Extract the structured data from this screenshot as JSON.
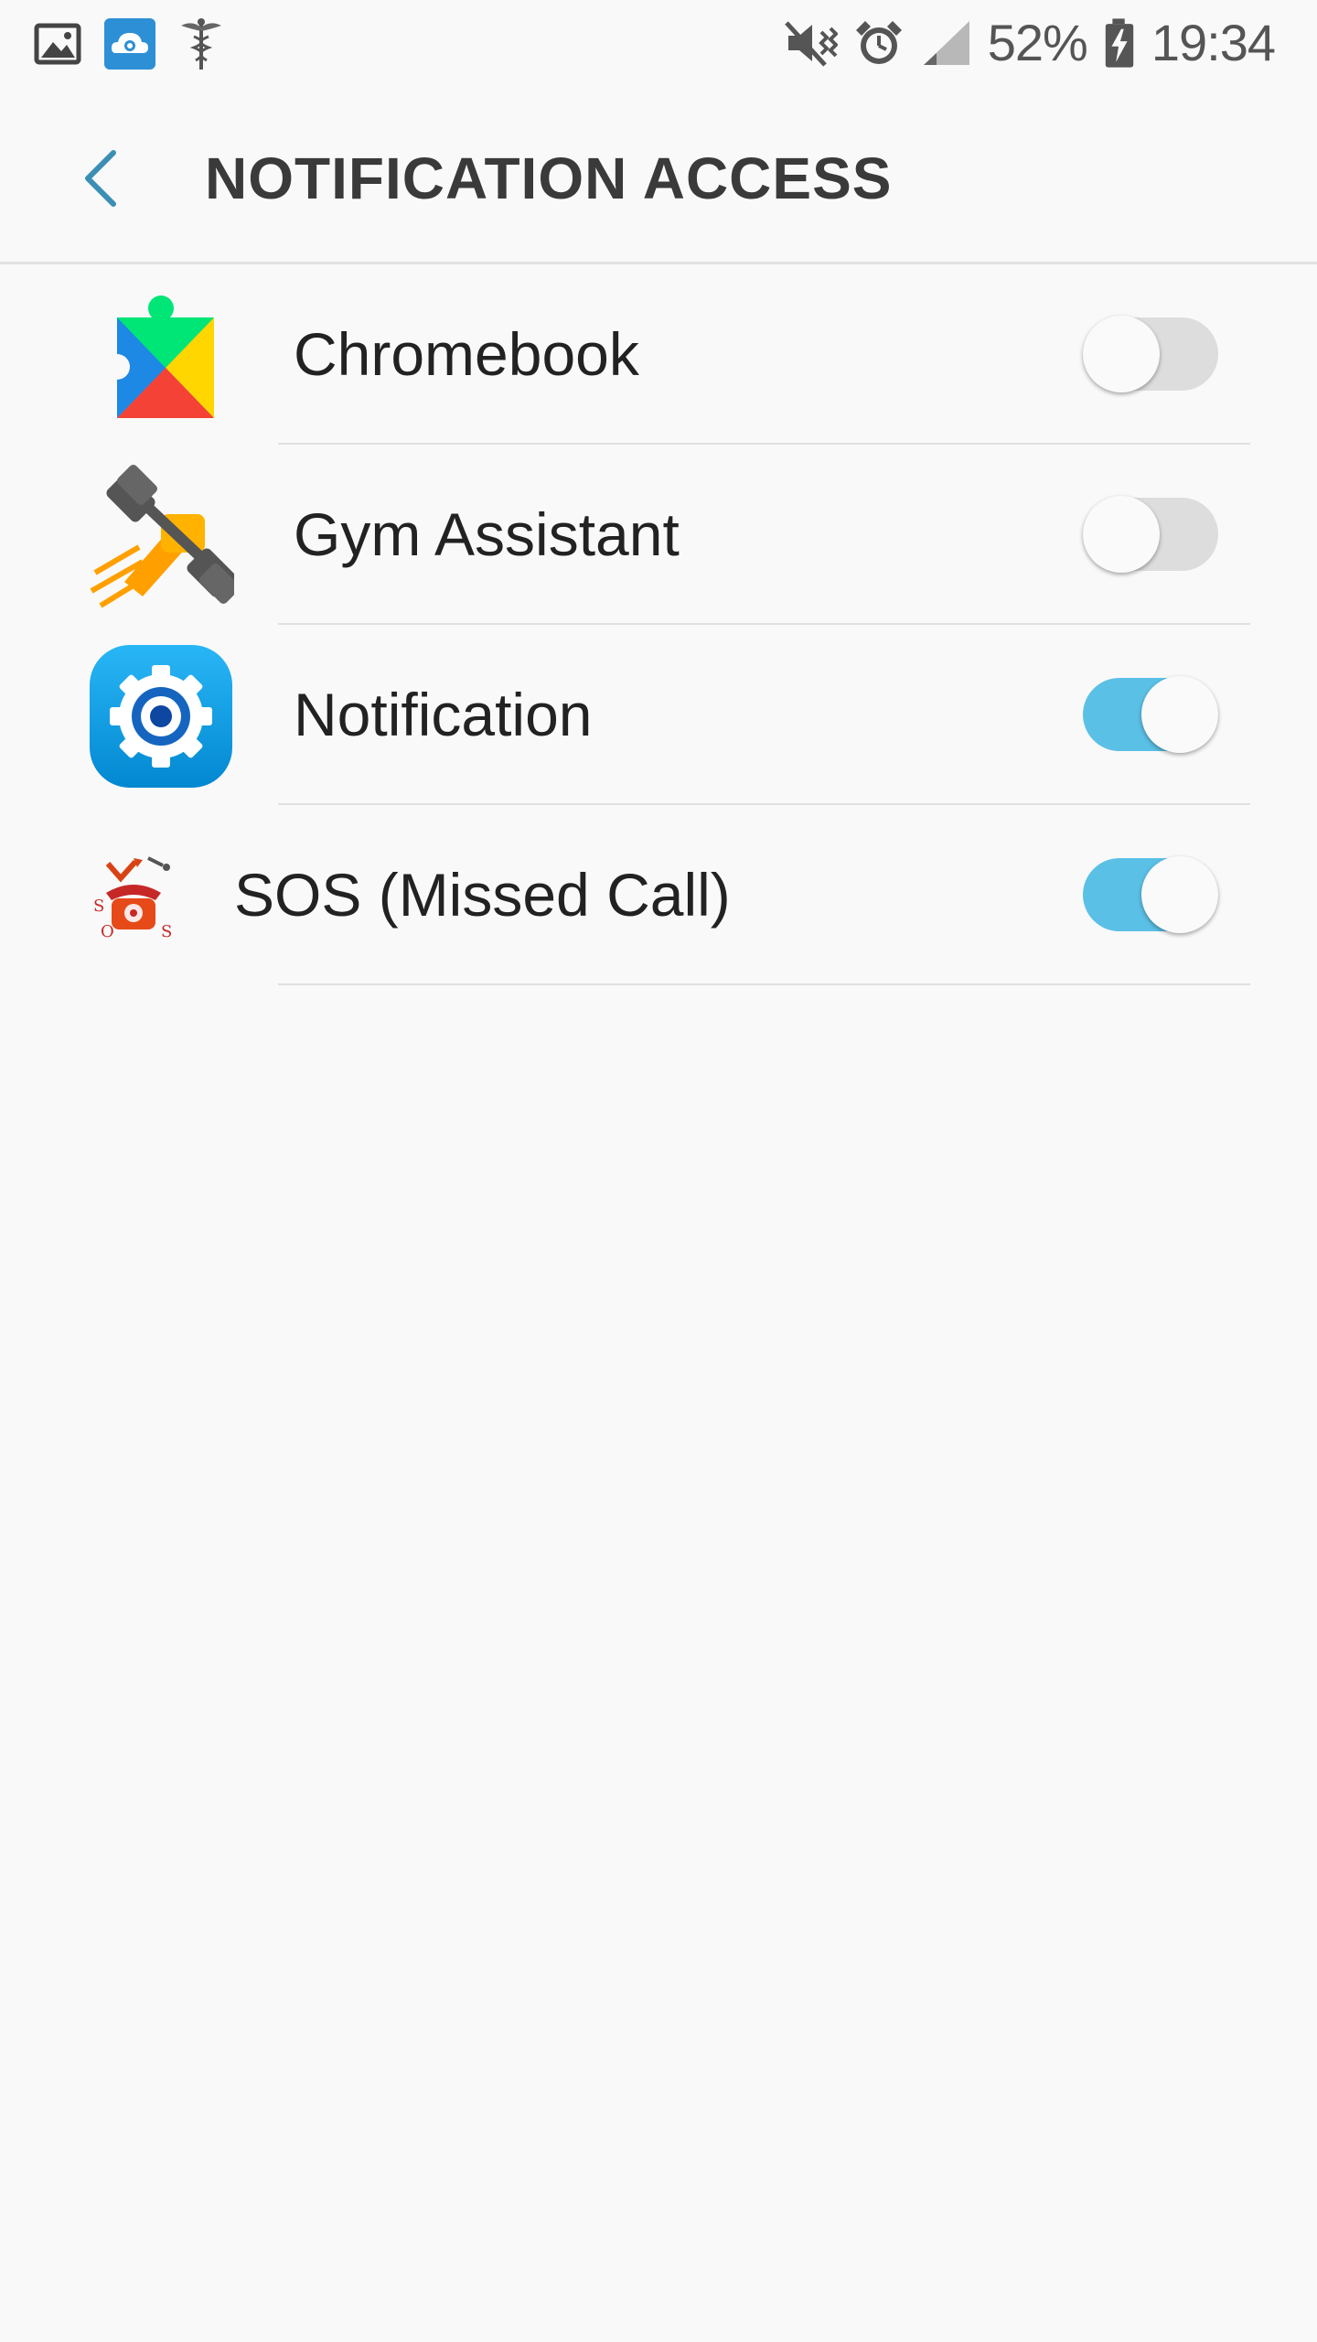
{
  "status_bar": {
    "battery_percent": "52%",
    "time": "19:34",
    "left_icons": [
      "gallery-icon",
      "cloud-camera-icon",
      "caduceus-icon"
    ],
    "right_icons": [
      "mute-vibrate-icon",
      "alarm-icon",
      "signal-icon",
      "battery-charging-icon"
    ]
  },
  "header": {
    "title": "NOTIFICATION ACCESS",
    "back_icon": "chevron-left-icon"
  },
  "colors": {
    "accent": "#5bc0e6",
    "back_chevron": "#3b8fb5",
    "toggle_off_track": "#dddddd"
  },
  "apps": [
    {
      "label": "Chromebook",
      "icon": "google-play-services-icon",
      "enabled": false
    },
    {
      "label": "Gym Assistant",
      "icon": "dumbbell-fist-icon",
      "enabled": false
    },
    {
      "label": "Notification",
      "icon": "gear-icon",
      "enabled": true
    },
    {
      "label": "SOS (Missed Call)",
      "icon": "sos-phone-icon",
      "enabled": true
    }
  ]
}
